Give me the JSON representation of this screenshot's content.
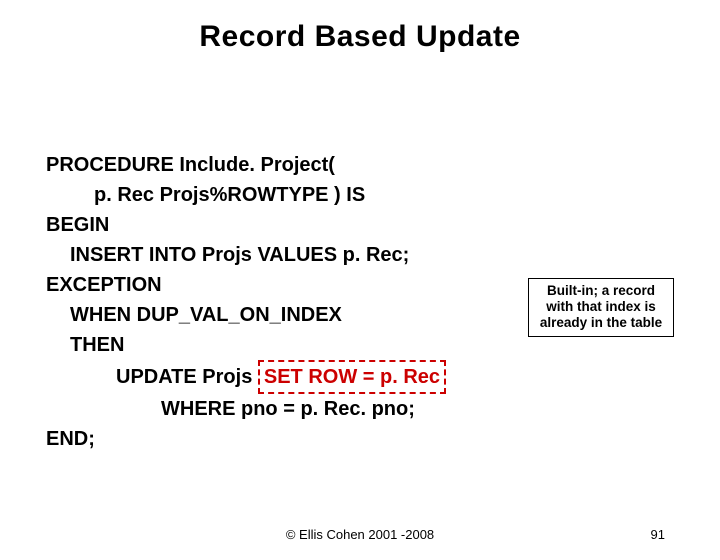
{
  "title": "Record Based Update",
  "code": {
    "l1": "PROCEDURE Include. Project(",
    "l2": "p. Rec Projs%ROWTYPE ) IS",
    "l3": "BEGIN",
    "l4": "INSERT INTO Projs VALUES p. Rec;",
    "l5": "EXCEPTION",
    "l6": "WHEN DUP_VAL_ON_INDEX",
    "l7": "THEN",
    "l8a": "UPDATE Projs ",
    "l8b": "SET ROW = p. Rec",
    "l9": "WHERE pno = p. Rec. pno;",
    "l10": "END;"
  },
  "callout": "Built-in; a record with that index is already in the table",
  "footer": "© Ellis Cohen 2001 -2008",
  "page": "91"
}
